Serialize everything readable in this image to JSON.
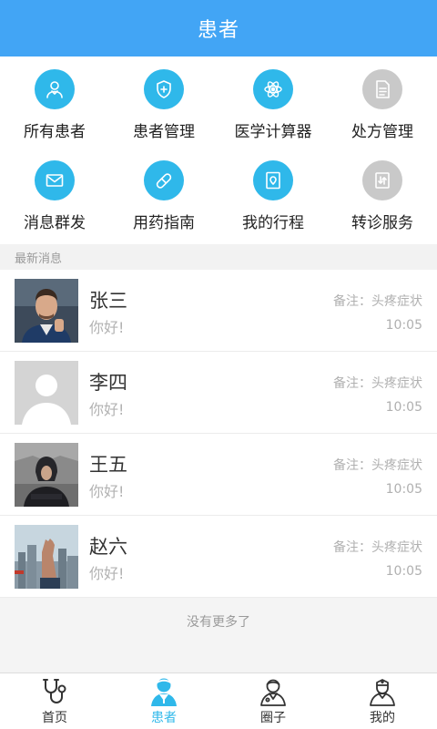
{
  "header": {
    "title": "患者"
  },
  "menu": [
    {
      "label": "所有患者",
      "icon": "patients-icon",
      "color": "#2fb8ea"
    },
    {
      "label": "患者管理",
      "icon": "shield-plus-icon",
      "color": "#2fb8ea"
    },
    {
      "label": "医学计算器",
      "icon": "atom-icon",
      "color": "#2fb8ea"
    },
    {
      "label": "处方管理",
      "icon": "document-icon",
      "color": "#c9c9c9"
    },
    {
      "label": "消息群发",
      "icon": "mail-icon",
      "color": "#2fb8ea"
    },
    {
      "label": "用药指南",
      "icon": "pill-icon",
      "color": "#2fb8ea"
    },
    {
      "label": "我的行程",
      "icon": "location-card-icon",
      "color": "#2fb8ea"
    },
    {
      "label": "转诊服务",
      "icon": "transfer-icon",
      "color": "#c9c9c9"
    }
  ],
  "section": {
    "title": "最新消息"
  },
  "messages": [
    {
      "name": "张三",
      "preview": "你好!",
      "note": "备注：头疼症状",
      "time": "10:05"
    },
    {
      "name": "李四",
      "preview": "你好!",
      "note": "备注：头疼症状",
      "time": "10:05"
    },
    {
      "name": "王五",
      "preview": "你好!",
      "note": "备注：头疼症状",
      "time": "10:05"
    },
    {
      "name": "赵六",
      "preview": "你好!",
      "note": "备注：头疼症状",
      "time": "10:05"
    }
  ],
  "footer_text": "没有更多了",
  "tabs": [
    {
      "label": "首页",
      "icon": "stethoscope-icon",
      "active": false
    },
    {
      "label": "患者",
      "icon": "patient-icon",
      "active": true
    },
    {
      "label": "圈子",
      "icon": "doctor-icon",
      "active": false
    },
    {
      "label": "我的",
      "icon": "nurse-icon",
      "active": false
    }
  ],
  "colors": {
    "header": "#42a5f5",
    "accent": "#2fb8ea"
  }
}
